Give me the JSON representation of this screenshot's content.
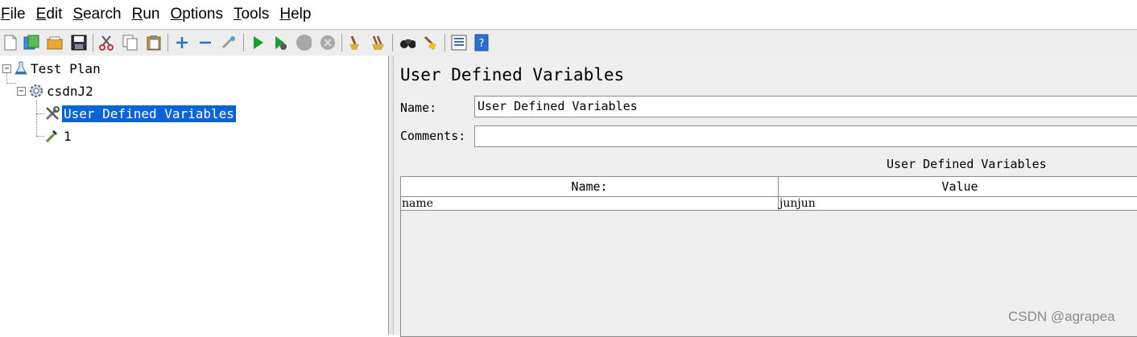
{
  "menu": [
    {
      "label": "File",
      "mnemonic": "F",
      "rest": "ile"
    },
    {
      "label": "Edit",
      "mnemonic": "E",
      "rest": "dit"
    },
    {
      "label": "Search",
      "mnemonic": "S",
      "rest": "earch"
    },
    {
      "label": "Run",
      "mnemonic": "R",
      "rest": "un"
    },
    {
      "label": "Options",
      "mnemonic": "O",
      "rest": "ptions"
    },
    {
      "label": "Tools",
      "mnemonic": "T",
      "rest": "ools"
    },
    {
      "label": "Help",
      "mnemonic": "H",
      "rest": "elp"
    }
  ],
  "toolbar": {
    "icons": [
      "new-icon",
      "templates-icon",
      "open-icon",
      "save-icon",
      "cut-icon",
      "copy-icon",
      "paste-icon",
      "expand-icon",
      "collapse-icon",
      "toggle-icon",
      "start-icon",
      "start-no-pauses-icon",
      "stop-icon",
      "shutdown-icon",
      "clear-icon",
      "clear-all-icon",
      "search-icon",
      "reset-search-icon",
      "function-helper-icon",
      "help-icon"
    ]
  },
  "tree": {
    "root": "Test Plan",
    "thread_group": "csdnJ2",
    "selected_item": "User Defined Variables",
    "sampler": "1"
  },
  "panel": {
    "title": "User Defined Variables",
    "name_label": "Name:",
    "name_value": "User Defined Variables",
    "comments_label": "Comments:",
    "comments_value": "",
    "table_title": "User Defined Variables",
    "columns": [
      "Name:",
      "Value"
    ],
    "rows": [
      {
        "name": "name",
        "value": "junjun"
      }
    ]
  },
  "watermark": "CSDN @agrapea",
  "colors": {
    "selection": "#0a64d6",
    "panel_bg": "#efefef"
  }
}
